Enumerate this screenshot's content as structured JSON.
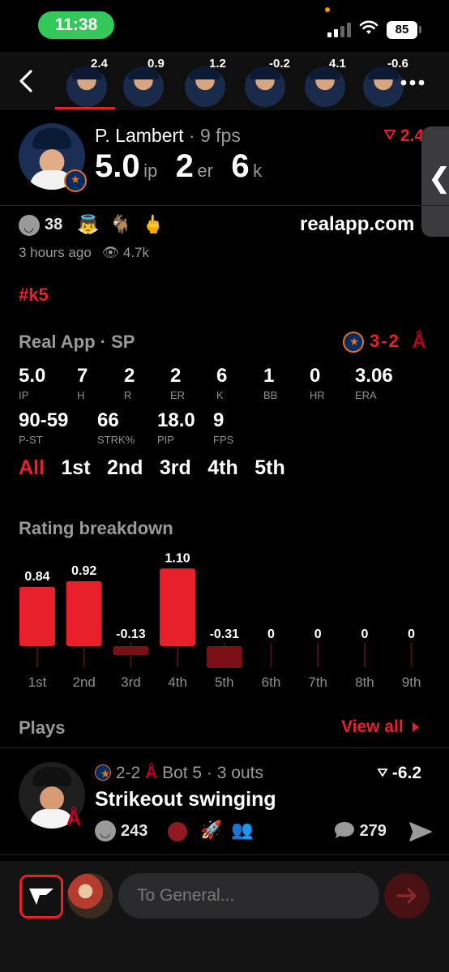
{
  "status_bar": {
    "time": "11:38",
    "battery": "85"
  },
  "strip": {
    "players": [
      {
        "rating": "2.4"
      },
      {
        "rating": "0.9"
      },
      {
        "rating": "1.2"
      },
      {
        "rating": "-0.2"
      },
      {
        "rating": "4.1"
      },
      {
        "rating": "-0.6"
      }
    ]
  },
  "header": {
    "name": "P. Lambert",
    "fps": " · 9 fps",
    "ip_value": "5.0",
    "ip_unit": "ip",
    "er_value": "2",
    "er_unit": "er",
    "k_value": "6",
    "k_unit": "k",
    "delta": "2.4"
  },
  "reactions": {
    "count": "38",
    "site": "realapp.com",
    "time_ago": "3 hours ago",
    "views": "4.7k"
  },
  "hashtag": "#k5",
  "game": {
    "title": "Real App · SP",
    "score_away": "3",
    "score_sep": "-",
    "score_home": "2",
    "stats_row1": [
      {
        "value": "5.0",
        "label": "IP"
      },
      {
        "value": "7",
        "label": "H"
      },
      {
        "value": "2",
        "label": "R"
      },
      {
        "value": "2",
        "label": "ER"
      },
      {
        "value": "6",
        "label": "K"
      },
      {
        "value": "1",
        "label": "BB"
      },
      {
        "value": "0",
        "label": "HR"
      },
      {
        "value": "3.06",
        "label": "ERA"
      }
    ],
    "stats_row2": [
      {
        "value": "90-59",
        "label": "P-ST"
      },
      {
        "value": "66",
        "label": "STRK%"
      },
      {
        "value": "18.0",
        "label": "PIP"
      },
      {
        "value": "9",
        "label": "FPS"
      }
    ],
    "inning_tabs": [
      "All",
      "1st",
      "2nd",
      "3rd",
      "4th",
      "5th"
    ],
    "active_tab": "All"
  },
  "breakdown": {
    "title": "Rating breakdown"
  },
  "chart_data": {
    "type": "bar",
    "title": "Rating breakdown",
    "categories": [
      "1st",
      "2nd",
      "3rd",
      "4th",
      "5th",
      "6th",
      "7th",
      "8th",
      "9th"
    ],
    "values": [
      0.84,
      0.92,
      -0.13,
      1.1,
      -0.31,
      0,
      0,
      0,
      0
    ],
    "value_labels": [
      "0.84",
      "0.92",
      "-0.13",
      "1.10",
      "-0.31",
      "0",
      "0",
      "0",
      "0"
    ],
    "colors": {
      "positive": "#e8202b",
      "negative": "#7a1016",
      "zero_tick": "#4a1114"
    }
  },
  "plays": {
    "title": "Plays",
    "view_all": "View all",
    "items": [
      {
        "score": "2-2",
        "context": "Bot 5 · 3 outs",
        "delta": "-6.2",
        "title": "Strikeout swinging",
        "reaction_count": "243",
        "comment_count": "279"
      }
    ]
  },
  "compose": {
    "placeholder": "To General..."
  },
  "colors": {
    "accent": "#e8202b",
    "background": "#000000",
    "muted": "#9a9a9a"
  }
}
